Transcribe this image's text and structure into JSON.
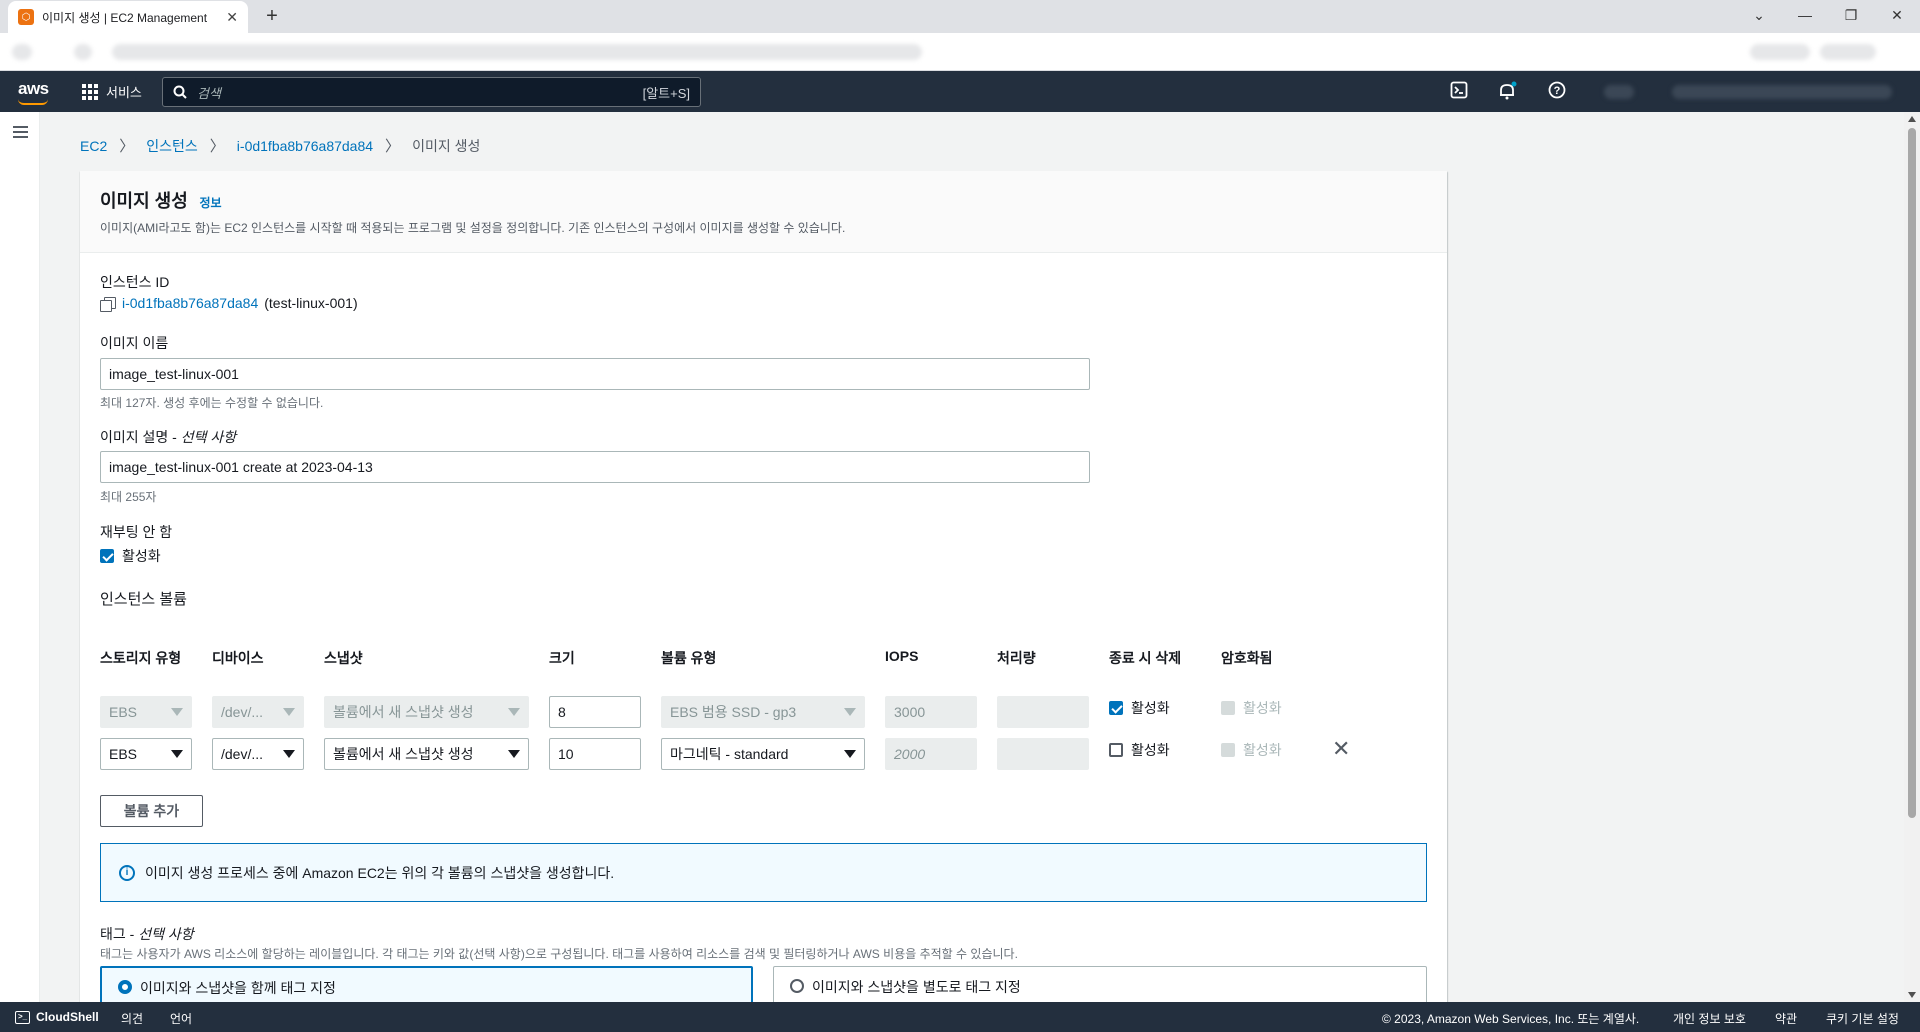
{
  "browser": {
    "tab_title": "이미지 생성 | EC2 Management",
    "new_tab": "+",
    "minimize": "—",
    "restore": "❐",
    "close": "✕"
  },
  "nav": {
    "logo": "aws",
    "services": "서비스",
    "search_placeholder": "검색",
    "search_shortcut": "[알트+S]"
  },
  "breadcrumb": {
    "items": [
      "EC2",
      "인스턴스",
      "i-0d1fba8b76a87da84"
    ],
    "current": "이미지 생성"
  },
  "header": {
    "title": "이미지 생성",
    "info": "정보",
    "description": "이미지(AMI라고도 함)는 EC2 인스턴스를 시작할 때 적용되는 프로그램 및 설정을 정의합니다. 기존 인스턴스의 구성에서 이미지를 생성할 수 있습니다."
  },
  "form": {
    "instance_id_label": "인스턴스 ID",
    "instance_id": "i-0d1fba8b76a87da84",
    "instance_name": "(test-linux-001)",
    "image_name_label": "이미지 이름",
    "image_name": "image_test-linux-001",
    "image_name_hint": "최대 127자. 생성 후에는 수정할 수 없습니다.",
    "image_desc_label": "이미지 설명 - ",
    "image_desc_optional": "선택 사항",
    "image_desc": "image_test-linux-001 create at 2023-04-13",
    "image_desc_hint": "최대 255자",
    "no_reboot_label": "재부팅 안 함",
    "no_reboot_enable": "활성화"
  },
  "volumes": {
    "section_title": "인스턴스 볼륨",
    "columns": [
      "스토리지 유형",
      "디바이스",
      "스냅샷",
      "크기",
      "볼륨 유형",
      "IOPS",
      "처리량",
      "종료 시 삭제",
      "암호화됨"
    ],
    "rows": [
      {
        "storage": "EBS",
        "device": "/dev/...",
        "snapshot": "볼륨에서 새 스냅샷 생성",
        "size": "8",
        "volume_type": "EBS 범용 SSD - gp3",
        "iops": "3000",
        "throughput": "",
        "delete_label": "활성화",
        "encrypted_label": "활성화"
      },
      {
        "storage": "EBS",
        "device": "/dev/...",
        "snapshot": "볼륨에서 새 스냅샷 생성",
        "size": "10",
        "volume_type": "마그네틱 - standard",
        "iops": "2000",
        "throughput": "",
        "delete_label": "활성화",
        "encrypted_label": "활성화"
      }
    ],
    "add_volume": "볼륨 추가",
    "remove": "✕"
  },
  "alert": {
    "text": "이미지 생성 프로세스 중에 Amazon EC2는 위의 각 볼륨의 스냅샷을 생성합니다."
  },
  "tags": {
    "label": "태그 - ",
    "optional": "선택 사항",
    "description": "태그는 사용자가 AWS 리소스에 할당하는 레이블입니다. 각 태그는 키와 값(선택 사항)으로 구성됩니다. 태그를 사용하여 리소스를 검색 및 필터링하거나 AWS 비용을 추적할 수 있습니다.",
    "option_together": "이미지와 스냅샷을 함께 태그 지정",
    "option_separate": "이미지와 스냅샷을 별도로 태그 지정"
  },
  "footer": {
    "cloudshell": "CloudShell",
    "feedback": "의견",
    "language": "언어",
    "copyright": "© 2023, Amazon Web Services, Inc. 또는 계열사.",
    "privacy": "개인 정보 보호",
    "terms": "약관",
    "cookies": "쿠키 기본 설정"
  },
  "colors": {
    "nav_bg": "#232f3e",
    "link": "#0073bb",
    "accent": "#ff9900"
  }
}
